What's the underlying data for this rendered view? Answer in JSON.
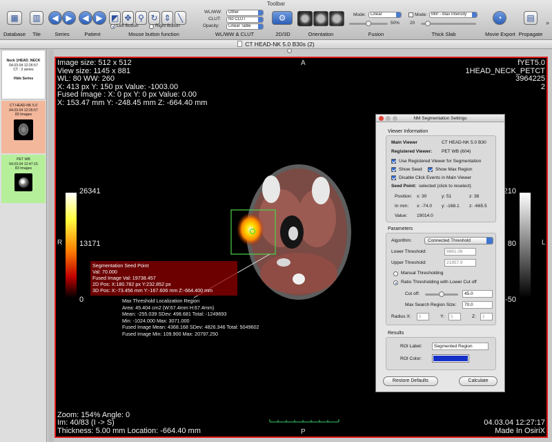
{
  "toolbar": {
    "title": "Toolbar",
    "labels": {
      "database": "Database",
      "tile": "Tile",
      "series": "Series",
      "patient": "Patient",
      "mouse": "Mouse button function",
      "wlww": "WL/WW & CLUT",
      "twod3d": "2D/3D",
      "orientation": "Orientation",
      "fusion": "Fusion",
      "thick_slab": "Thick Slab",
      "movie_export": "Movie Export",
      "propagate": "Propagate"
    },
    "mouse_left": "Left Button",
    "mouse_right": "Right Button",
    "wlww_label": "WL/WW:",
    "wlww_value": "Other",
    "clut_label": "CLUT:",
    "clut_value": "No CLUT",
    "opacity_label": "Opacity:",
    "opacity_value": "Linear Table",
    "fusion_mode_label": "Mode:",
    "fusion_mode_value": "Linear",
    "fusion_percent": "50%",
    "slab_mode_label": "Mode:",
    "slab_mode_value": "MIP - Max Intensity",
    "slab_value": "20"
  },
  "window_title": "CT HEAD-NK 5.0 B30s (2)",
  "sidebar": {
    "header": {
      "name": "Neck 1HEAD_NECK",
      "date": "04.03.04 12:26:57",
      "count": "CT : 2 series",
      "button": "Hide Series"
    },
    "series": [
      {
        "name": "CT HEAD-NK 5.0",
        "date": "04.03.04 12:26:57",
        "count": "83 Images",
        "color": "#f3b79b"
      },
      {
        "name": "PET WB",
        "date": "04.03.04 12:47:15",
        "count": "83 Images",
        "color": "#b6ef9a"
      }
    ]
  },
  "viewer": {
    "top_left": [
      "Image size: 512 x 512",
      "View size: 1145 x 881",
      "WL: 80 WW: 260",
      "X: 413 px Y: 150 px Value: -1003.00",
      "Fused Image : X: 0 px Y: 0 px Value: 0.00",
      "X: 153.47 mm Y: -248.45 mm Z: -664.40 mm"
    ],
    "top_right": [
      "fYET5.0",
      "1HEAD_NECK_PETCT",
      "3964225",
      "2"
    ],
    "bottom_left": [
      "Zoom: 154% Angle: 0",
      "Im: 40/83  (I -> S)",
      "Thickness: 5.00 mm Location: -664.40 mm"
    ],
    "bottom_right": [
      "04.03.04 12:27:17",
      "Made In OsiriX"
    ],
    "orient_top": "A",
    "orient_bottom": "P",
    "orient_left": "R",
    "orient_right": "L",
    "left_bar": {
      "max": "26341",
      "mid": "13171",
      "min": "0"
    },
    "right_bar": {
      "max": "210",
      "mid": "80",
      "min": "-50"
    },
    "seed_box": [
      "Segmentation Seed Point",
      "Val: 70.000",
      "Fused Image Val: 19738.457",
      "2D Pos: X:180.782 px Y:232.852 px",
      "3D Pos: X:-73.456 mm Y:-167.606 mm Z:-664.400 mm"
    ],
    "roi_text": [
      "Max Threshold Localization Region",
      "Area: 45.404 cm2 (W:67.4mm H:67.4mm)",
      "Mean: -255.039 SDev: 498.681 Total: -1249693",
      "Min: -1024.000 Max: 3071.000",
      "Fused Image Mean: 4368.168 SDev: 4826.346 Total: 5049602",
      "Fused Image Min: 109.900 Max: 20797.250"
    ]
  },
  "panel": {
    "title": "NM Segmentation Settings",
    "viewer_info_label": "Viewer Information",
    "main_viewer_label": "Main Viewer",
    "main_viewer_value": "CT HEAD-NK 5.0 B30",
    "registered_label": "Registered Viewer:",
    "registered_value": "PET WB (604)",
    "cb_use_registered": "Use Registered Viewer for Segmentation",
    "cb_show_seed": "Show Seed",
    "cb_show_max_region": "Show Max Region",
    "cb_disable_click": "Disable Click Events in Main Viewer",
    "seed_label": "Seed Point:",
    "seed_value": "selected (click to reselect)",
    "position_label": "Position:",
    "pos_x": "x:  30",
    "pos_y": "y:  51",
    "pos_z": "z:  38",
    "mm_label": "In mm:",
    "mm_x": "x:  -74.0",
    "mm_y": "y:  -168.1",
    "mm_z": "z:  -665.5",
    "value_label": "Value:",
    "value_value": "19014.0",
    "parameters_label": "Parameters",
    "algorithm_label": "Algorithm:",
    "algorithm_value": "Connected Threshold",
    "lower_label": "Lower Threshold:",
    "lower_value": "9881.06",
    "upper_label": "Upper Threshold:",
    "upper_value": "21957.9",
    "radio_manual": "Manual Thresholding",
    "radio_ratio": "Ratio Thresholding with Lower Cut off",
    "cutoff_label": "Cut off:",
    "cutoff_value": "45.0",
    "max_search_label": "Max Search Region Size:",
    "max_search_value": "70.0",
    "radius_x_label": "Radius X:",
    "radius_x_value": "1",
    "radius_y_label": "Y:",
    "radius_y_value": "1",
    "radius_z_label": "Z:",
    "radius_z_value": "1",
    "results_label": "Results",
    "roi_label_label": "ROI Label:",
    "roi_label_value": "Segmented Region",
    "roi_color_label": "ROI Color:",
    "roi_color": "#1530c8",
    "restore_button": "Restore Defaults",
    "calculate_button": "Calculate"
  }
}
